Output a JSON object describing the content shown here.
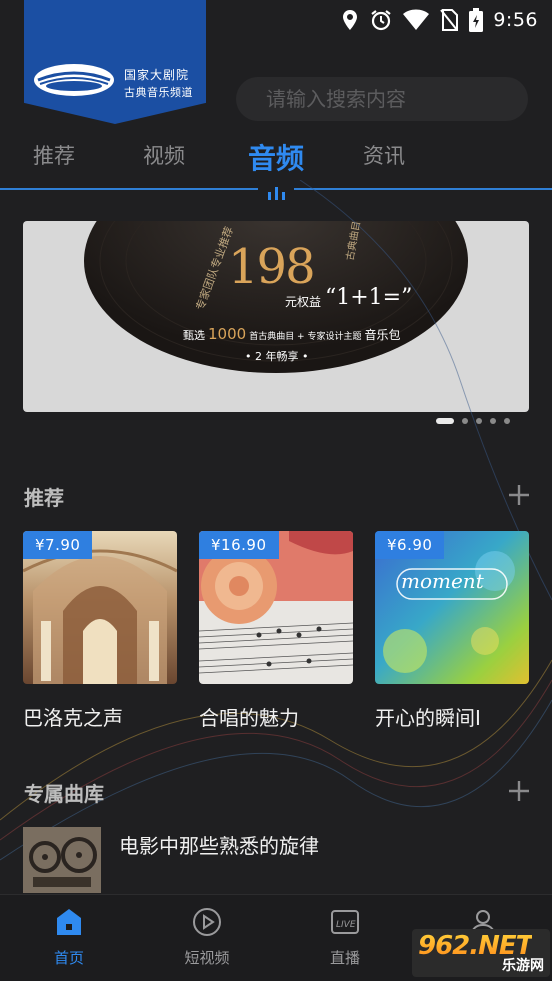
{
  "status_bar": {
    "time": "9:56",
    "icons": [
      "location-icon",
      "alarm-icon",
      "wifi-icon",
      "no-sim-icon",
      "battery-charging-icon"
    ]
  },
  "logo": {
    "line1": "国家大剧院",
    "line2": "古典音乐频道",
    "brand_color": "#1b4fa3"
  },
  "search": {
    "placeholder": "请输入搜索内容",
    "icon": "search-icon"
  },
  "tabs": [
    {
      "label": "推荐",
      "active": false
    },
    {
      "label": "视频",
      "active": false
    },
    {
      "label": "音频",
      "active": true
    },
    {
      "label": "资讯",
      "active": false
    }
  ],
  "banner": {
    "price_text": "198",
    "price_unit": "元权益",
    "offer": "“1+1=”",
    "detail_prefix": "甄选",
    "detail_count": "1000",
    "detail_mid": "首古典曲目 + 专家设计主题",
    "detail_suffix": "音乐包",
    "duration": "• 2 年畅享 •",
    "dots_total": 5,
    "dots_active": 1
  },
  "recommend": {
    "title": "推荐",
    "items": [
      {
        "price": "¥7.90",
        "title": "巴洛克之声"
      },
      {
        "price": "¥16.90",
        "title": "合唱的魅力"
      },
      {
        "price": "¥6.90",
        "title": "开心的瞬间I",
        "image_text": "moment"
      }
    ]
  },
  "library": {
    "title": "专属曲库",
    "items": [
      {
        "title": "电影中那些熟悉的旋律"
      }
    ]
  },
  "bottom_nav": [
    {
      "label": "首页",
      "icon": "home-icon",
      "active": true
    },
    {
      "label": "短视频",
      "icon": "play-circle-icon",
      "active": false
    },
    {
      "label": "直播",
      "icon": "live-icon",
      "active": false
    },
    {
      "label": "",
      "icon": "profile-icon",
      "active": false
    }
  ],
  "watermark": {
    "main": "962.NET",
    "sub": "乐游网"
  },
  "colors": {
    "accent": "#2f8af0",
    "background": "#1f1f21",
    "price_badge": "#2f7fe0"
  }
}
